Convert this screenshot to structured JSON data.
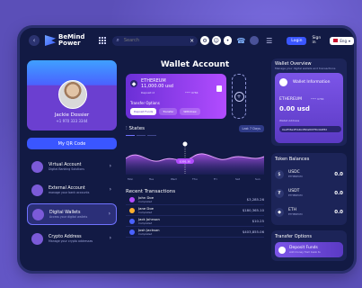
{
  "app": {
    "name_line1": "BeMind",
    "name_line2": "Power"
  },
  "topbar": {
    "search_placeholder": "Search",
    "login_label": "Login",
    "signin_label": "Sign in",
    "language": "Eng"
  },
  "profile": {
    "name": "Jackie Dossier",
    "phone": "+1 970 333 3344"
  },
  "left": {
    "qr_label": "My QR Code",
    "menu": [
      {
        "label": "Virtual Account",
        "sub": "Digital Banking Solutions"
      },
      {
        "label": "External Account",
        "sub": "manage your bank accounts"
      },
      {
        "label": "Digital Wallets",
        "sub": "Access your digital wallets"
      },
      {
        "label": "Crypto Address",
        "sub": "Manage your crypto addresses"
      }
    ]
  },
  "wallet": {
    "title": "Wallet Account",
    "card": {
      "coin": "ETHEREUM",
      "value": "11,000.00 usd",
      "id_label": "Deposit id",
      "id_value": "**** 9784",
      "transfer_options": "Transfer Options",
      "pill1": "Deposit Funds",
      "pill2": "Transfer",
      "pill3": "Withdraw"
    },
    "states_title": "States",
    "states_period": "Last 7 Days",
    "chart_marker": "$395.30",
    "x_ticks": [
      "Mon",
      "Tue",
      "Wed",
      "Thu",
      "Fri",
      "Sat",
      "Sun"
    ]
  },
  "transactions": {
    "title": "Recent Transactions",
    "items": [
      {
        "name": "John Doe",
        "status": "Completed",
        "amount": "$3,285.26"
      },
      {
        "name": "Jane Doe",
        "status": "Completed",
        "amount": "$180,365.10"
      },
      {
        "name": "Jack Johnson",
        "status": "Completed",
        "amount": "$10.25"
      },
      {
        "name": "Josh Jackson",
        "status": "Completed",
        "amount": "$403,855.06"
      }
    ]
  },
  "overview": {
    "title": "Wallet Overview",
    "subtitle": "Manage your digital wallets and transactions",
    "card_title": "Wallet Information",
    "coin": "ETHEREUM",
    "deposit_id": "**** 9784",
    "usd": "0.00 usd",
    "address_label": "Wallet Address",
    "address": "0xeff36a4f5b4b4f8da897f5b4b4f8d"
  },
  "token_balances": {
    "title": "Token Balances",
    "items": [
      {
        "symbol": "USDC",
        "network": "ETHEREUM",
        "value": "0.0"
      },
      {
        "symbol": "USDT",
        "network": "ETHEREUM",
        "value": "0.0"
      },
      {
        "symbol": "ETH",
        "network": "ETHEREUM",
        "value": "0.0"
      }
    ]
  },
  "transfer_options": {
    "title": "Transfer Options",
    "deposit_title": "Deposit Funds",
    "deposit_sub": "Add money from bank to"
  },
  "colors": {
    "accent": "#3a56ff",
    "card": "#7c55e8",
    "bg": "#121a44"
  }
}
